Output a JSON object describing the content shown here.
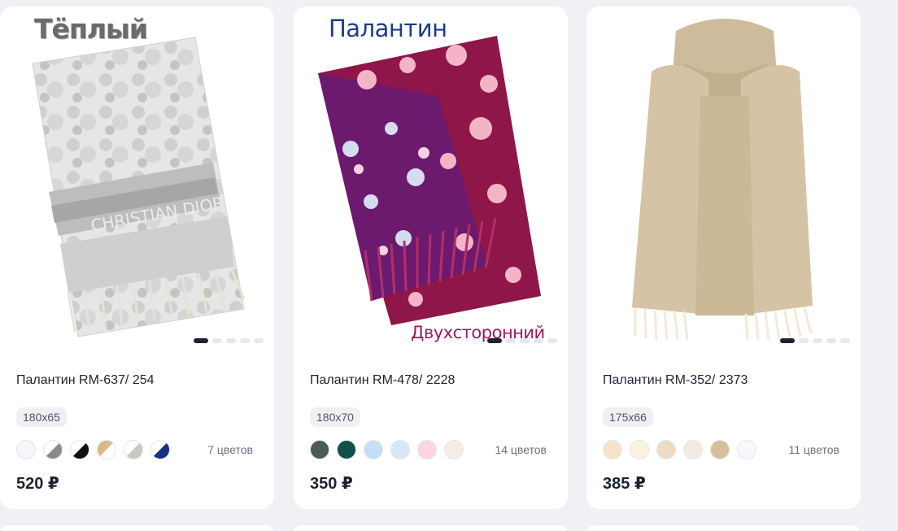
{
  "products": [
    {
      "overlay": "Тёплый",
      "title": "Палантин RM-637/ 254",
      "size": "180x65",
      "colors_count": "7 цветов",
      "price": "520 ₽",
      "swatch_colors": [
        "#f5f7fa",
        "split:#ffffff:#8a8a8a",
        "split:#ffffff:#111111",
        "split:#ffffff:#d8b98a",
        "split:#ffffff:#c8c8c0",
        "split:#ffffff:#1b2f86"
      ],
      "active_slide": 1,
      "slides": 5
    },
    {
      "overlay": "Палантин",
      "overlay_bottom": "Двухсторонний",
      "title": "Палантин RM-478/ 2228",
      "size": "180x70",
      "colors_count": "14 цветов",
      "price": "350 ₽",
      "swatch_colors": [
        "#4c5a58",
        "#0f5146",
        "#c5dff8",
        "#d7e6f5",
        "#fbd6df",
        "#f4ece6"
      ],
      "active_slide": 1,
      "slides": 5
    },
    {
      "title": "Палантин RM-352/ 2373",
      "size": "175x66",
      "colors_count": "11 цветов",
      "price": "385 ₽",
      "swatch_colors": [
        "#f6e2c8",
        "#fbf3df",
        "#eedcc2",
        "#f3ebe1",
        "#d8bf9b",
        "#f7f8fb"
      ],
      "active_slide": 1,
      "slides": 5
    }
  ]
}
